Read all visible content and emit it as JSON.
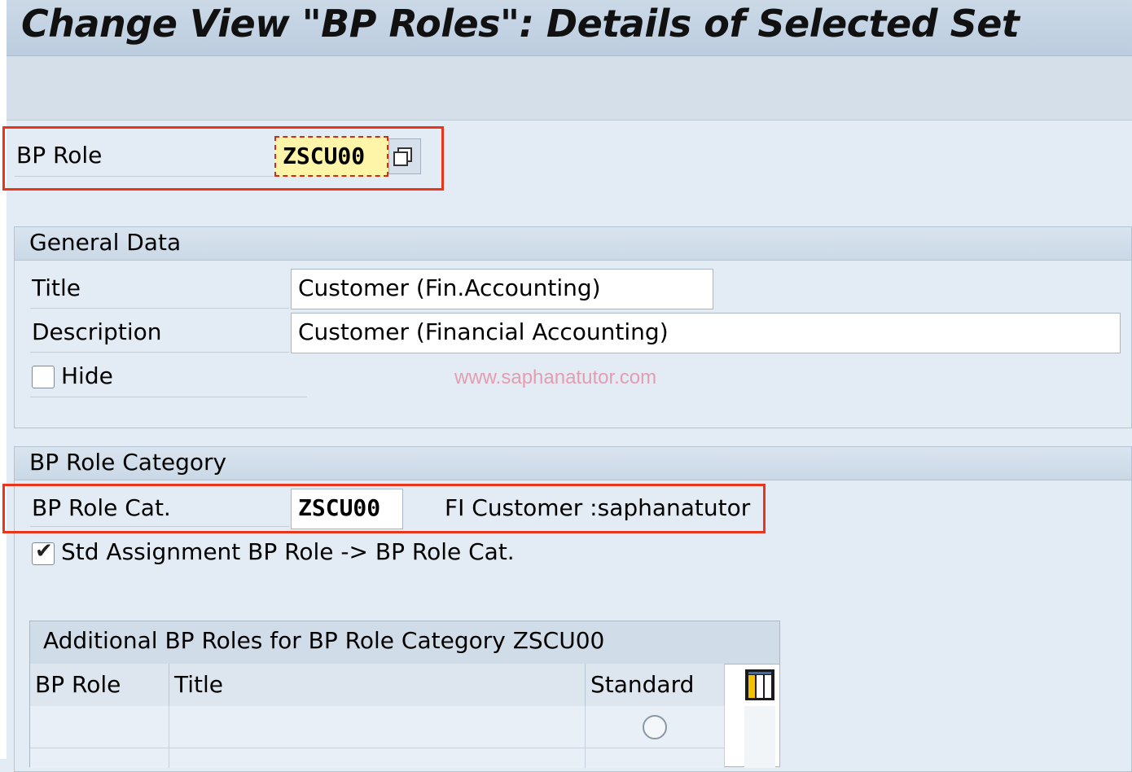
{
  "window": {
    "title": "Change View \"BP Roles\": Details of Selected Set"
  },
  "bp_role": {
    "label": "BP Role",
    "value": "ZSCU00",
    "copy_icon": "copy-icon"
  },
  "general_data": {
    "heading": "General Data",
    "title_label": "Title",
    "title_value": "Customer (Fin.Accounting)",
    "description_label": "Description",
    "description_value": "Customer (Financial Accounting)",
    "hide_label": "Hide",
    "hide_checked": false
  },
  "watermark": "www.saphanatutor.com",
  "role_category": {
    "heading": "BP Role Category",
    "cat_label": "BP Role Cat.",
    "cat_value": "ZSCU00",
    "cat_description": "FI Customer :saphanatutor",
    "std_assignment_label": "Std Assignment BP Role -> BP Role Cat.",
    "std_assignment_checked": true
  },
  "additional_roles_table": {
    "title": "Additional BP Roles for BP Role Category ZSCU00",
    "columns": [
      "BP Role",
      "Title",
      "Standard"
    ],
    "settings_icon": "table-settings-icon",
    "rows": [
      {
        "bp_role": "",
        "title": "",
        "standard": false
      }
    ]
  },
  "colors": {
    "highlight": "#e8351b",
    "field_active": "#fff5a8",
    "title_bar": "#c4d4e4"
  }
}
